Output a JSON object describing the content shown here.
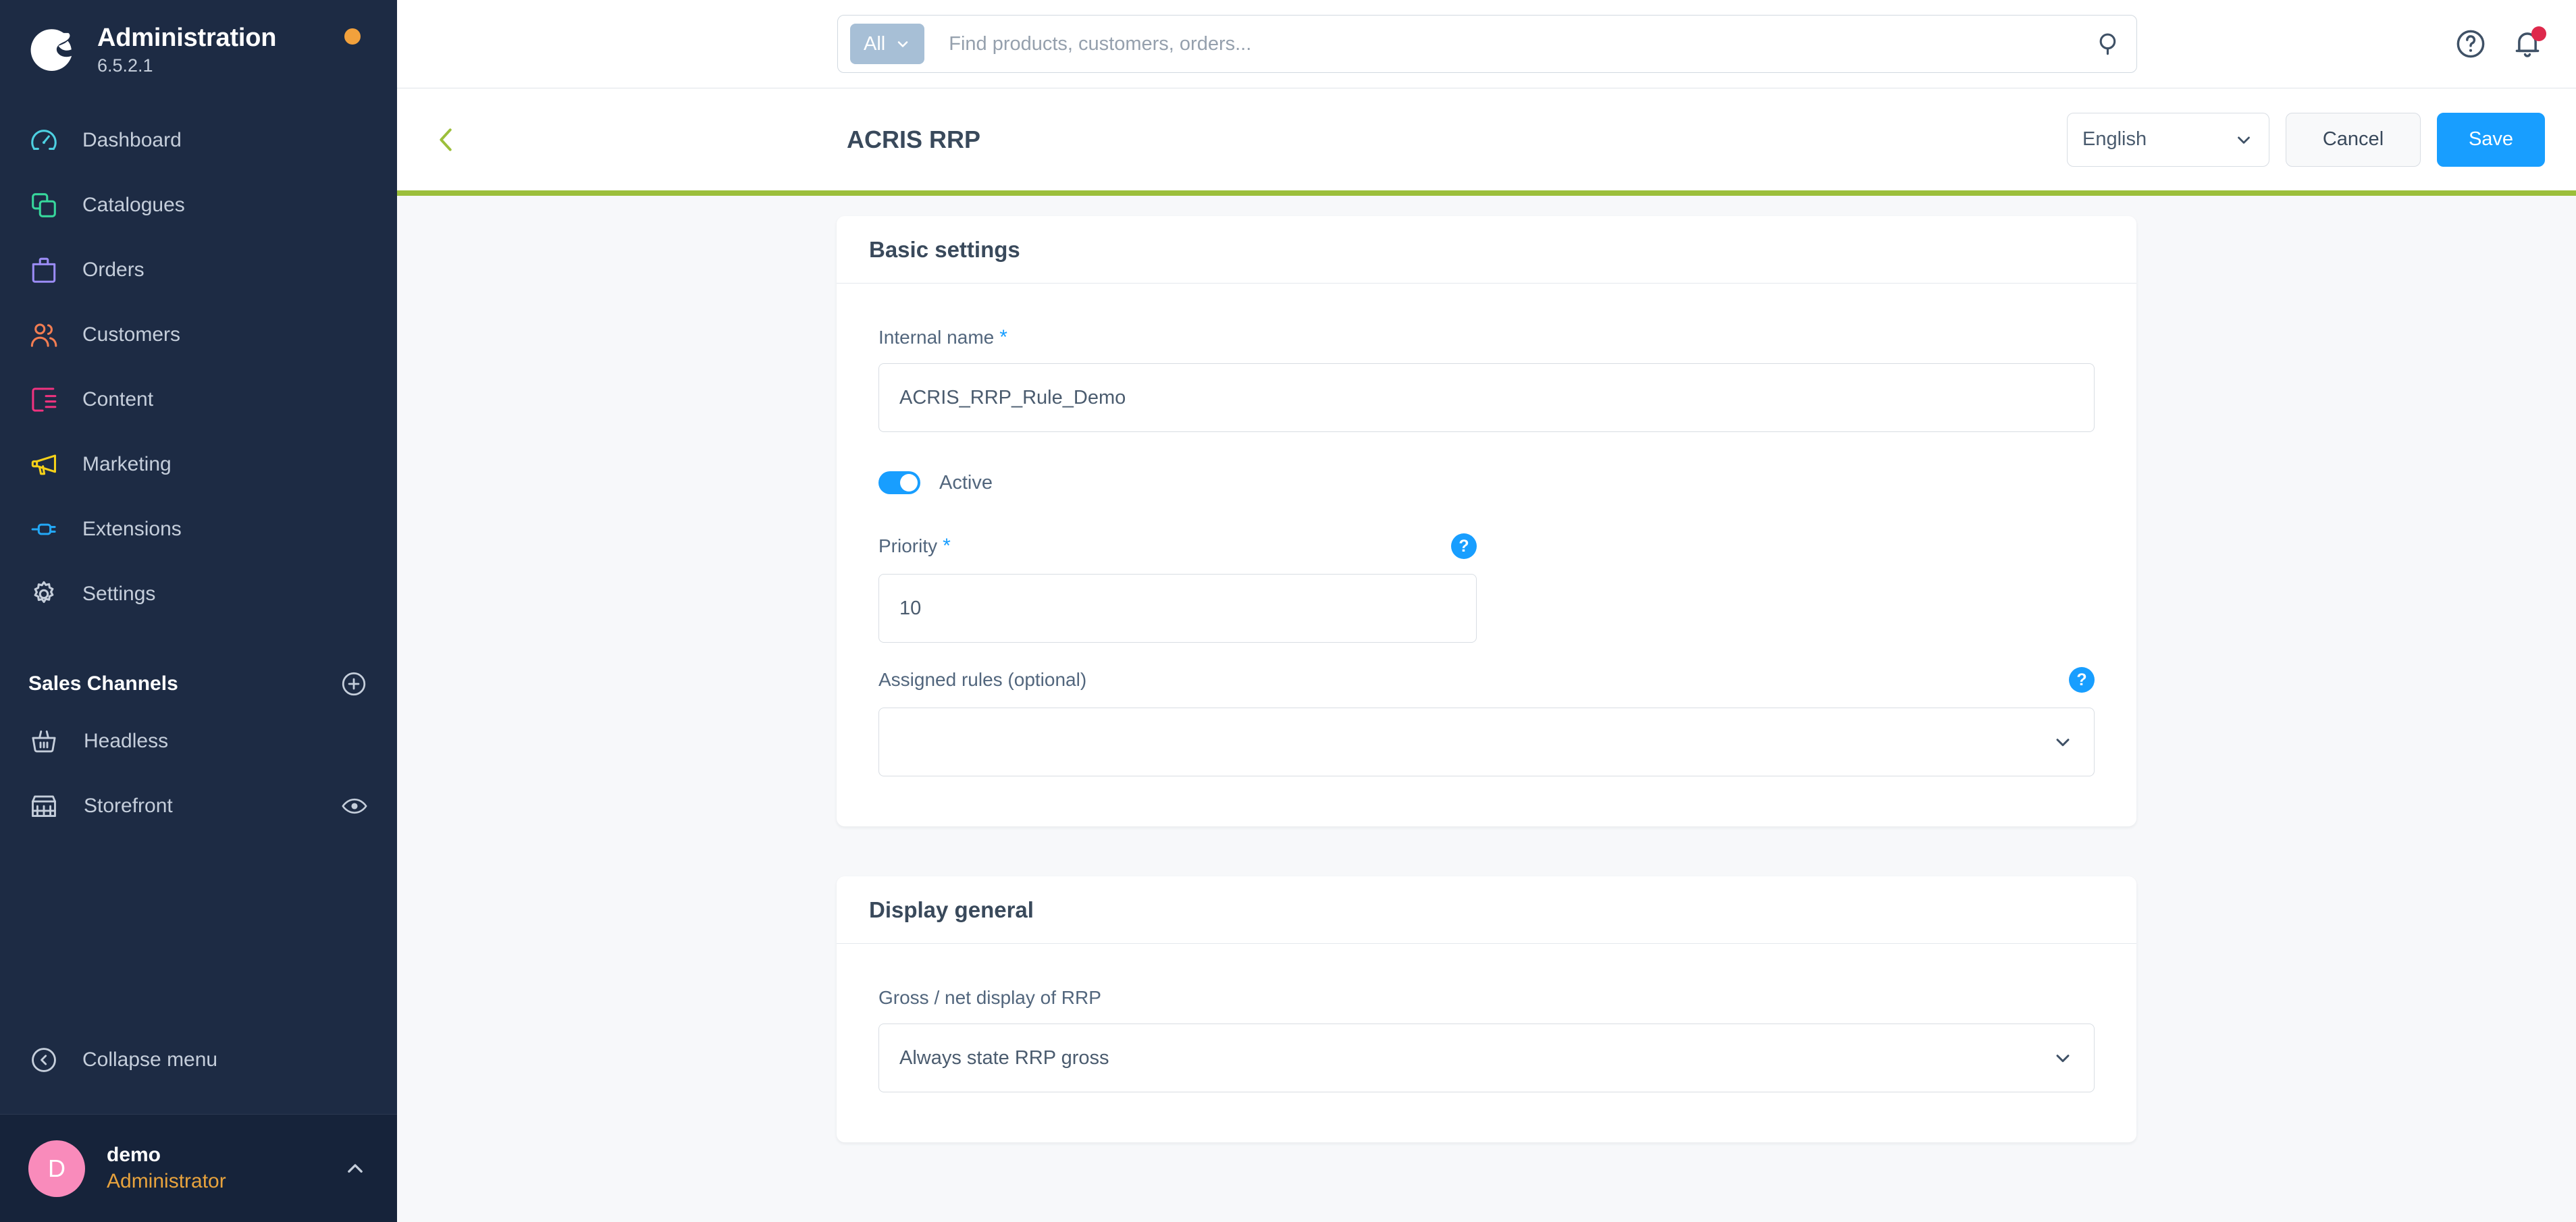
{
  "brand": {
    "logo_icon": "shopware-logo-icon",
    "title": "Administration",
    "version": "6.5.2.1",
    "status_dot_color": "#f2a13c"
  },
  "sidebar": {
    "items": [
      {
        "label": "Dashboard",
        "icon": "speedometer-icon",
        "color": "#4dd0e1"
      },
      {
        "label": "Catalogues",
        "icon": "copy-layers-icon",
        "color": "#37d79c"
      },
      {
        "label": "Orders",
        "icon": "shopping-bag-icon",
        "color": "#9b8cf5"
      },
      {
        "label": "Customers",
        "icon": "users-icon",
        "color": "#f27d52"
      },
      {
        "label": "Content",
        "icon": "content-list-icon",
        "color": "#f0337f"
      },
      {
        "label": "Marketing",
        "icon": "megaphone-icon",
        "color": "#f5d119"
      },
      {
        "label": "Extensions",
        "icon": "plug-icon",
        "color": "#23a7f5"
      },
      {
        "label": "Settings",
        "icon": "gear-icon",
        "color": "#c5cedb"
      }
    ],
    "sales_channels": {
      "title": "Sales Channels",
      "add_icon": "plus-circle-icon",
      "channels": [
        {
          "label": "Headless",
          "icon": "basket-icon",
          "has_preview": false
        },
        {
          "label": "Storefront",
          "icon": "storefront-icon",
          "has_preview": true,
          "preview_icon": "eye-icon"
        }
      ]
    },
    "collapse": {
      "label": "Collapse menu",
      "icon": "chevron-left-circle-icon"
    },
    "user": {
      "avatar_initial": "D",
      "avatar_color": "#f98bbb",
      "name": "demo",
      "role": "Administrator",
      "role_color": "#e8a33d",
      "chevron_icon": "chevron-up-icon"
    }
  },
  "topbar": {
    "search": {
      "scope_label": "All",
      "scope_chevron_icon": "chevron-down-icon",
      "placeholder": "Find products, customers, orders...",
      "value": "",
      "submit_icon": "search-icon"
    },
    "help_icon": "question-circle-icon",
    "notifications_icon": "bell-icon",
    "notification_badge_color": "#de294c"
  },
  "page_header": {
    "back_icon": "chevron-left-icon",
    "back_icon_color": "#9cbf3b",
    "title": "ACRIS RRP",
    "accent_border_color": "#9cbf3b",
    "language": {
      "value": "English",
      "chevron_icon": "chevron-down-icon"
    },
    "cancel_label": "Cancel",
    "save_label": "Save",
    "save_color": "#189eff"
  },
  "cards": [
    {
      "title": "Basic settings",
      "fields": [
        {
          "kind": "text",
          "label": "Internal name",
          "required": true,
          "value": "ACRIS_RRP_Rule_Demo",
          "placeholder": "",
          "help": false
        },
        {
          "kind": "toggle",
          "label": "Active",
          "checked": true
        },
        {
          "kind": "text",
          "label": "Priority",
          "required": true,
          "value": "10",
          "placeholder": "",
          "help": true
        },
        {
          "kind": "select",
          "label": "Assigned rules (optional)",
          "required": false,
          "value": "",
          "help": true,
          "chevron_icon": "chevron-down-icon"
        }
      ]
    },
    {
      "title": "Display general",
      "fields": [
        {
          "kind": "select",
          "label": "Gross / net display of RRP",
          "required": false,
          "value": "Always state RRP gross",
          "help": false,
          "chevron_icon": "chevron-down-icon"
        }
      ]
    }
  ]
}
